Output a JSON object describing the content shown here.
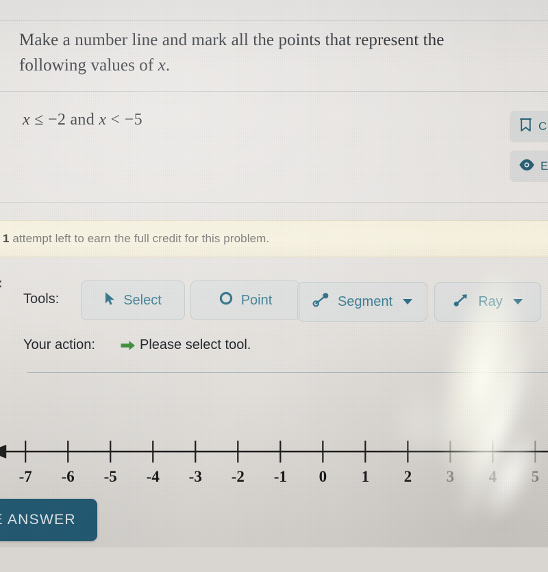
{
  "problem": {
    "prompt_line1": "Make a number line and mark all the points that represent the",
    "prompt_line2_prefix": "following values of ",
    "prompt_line2_var": "x",
    "prompt_line2_suffix": ".",
    "expression_var1": "x",
    "expression_rel1": " ≤ −2 ",
    "expression_conj": "and",
    "expression_var2": " x",
    "expression_rel2": " < −5"
  },
  "side_actions": [
    {
      "label": "C",
      "icon": "bookmark-icon"
    },
    {
      "label": "E",
      "icon": "eye-icon"
    }
  ],
  "banner": {
    "count": "1",
    "text": " attempt left to earn the full credit for this problem."
  },
  "edge_marker": ":",
  "tools": {
    "label": "Tools:",
    "items": [
      {
        "label": "Select",
        "icon": "cursor-arrow-icon",
        "has_caret": false
      },
      {
        "label": "Point",
        "icon": "circle-outline-icon",
        "has_caret": false
      },
      {
        "label": "Segment",
        "icon": "segment-icon",
        "has_caret": true
      },
      {
        "label": "Ray",
        "icon": "ray-icon",
        "has_caret": true
      }
    ]
  },
  "action": {
    "label": "Your action:",
    "arrow_icon": "green-arrow-right-icon",
    "text": "Please select tool.",
    "arrow_color": "#3f8f3f"
  },
  "answer_button": {
    "label": "DE ANSWER"
  },
  "chart_data": {
    "type": "line",
    "title": "",
    "xlabel": "",
    "ylabel": "",
    "grid": false,
    "axis_ticks": [
      -7,
      -6,
      -5,
      -4,
      -3,
      -2,
      -1,
      0,
      1,
      2,
      3,
      4,
      5
    ],
    "tick_labels": [
      "-7",
      "-6",
      "-5",
      "-4",
      "-3",
      "-2",
      "-1",
      "0",
      "1",
      "2",
      "3",
      "4",
      "5"
    ],
    "xlim": [
      -7.6,
      5.3
    ],
    "left_arrow": true,
    "right_arrow": false,
    "marked_points": [],
    "axis_color": "#1c1c1c"
  },
  "colors": {
    "accent_teal": "#3b7d92",
    "answer_button_bg": "#1d5873",
    "banner_bg": "#f4efdc",
    "page_bg": "#e4e1de"
  }
}
